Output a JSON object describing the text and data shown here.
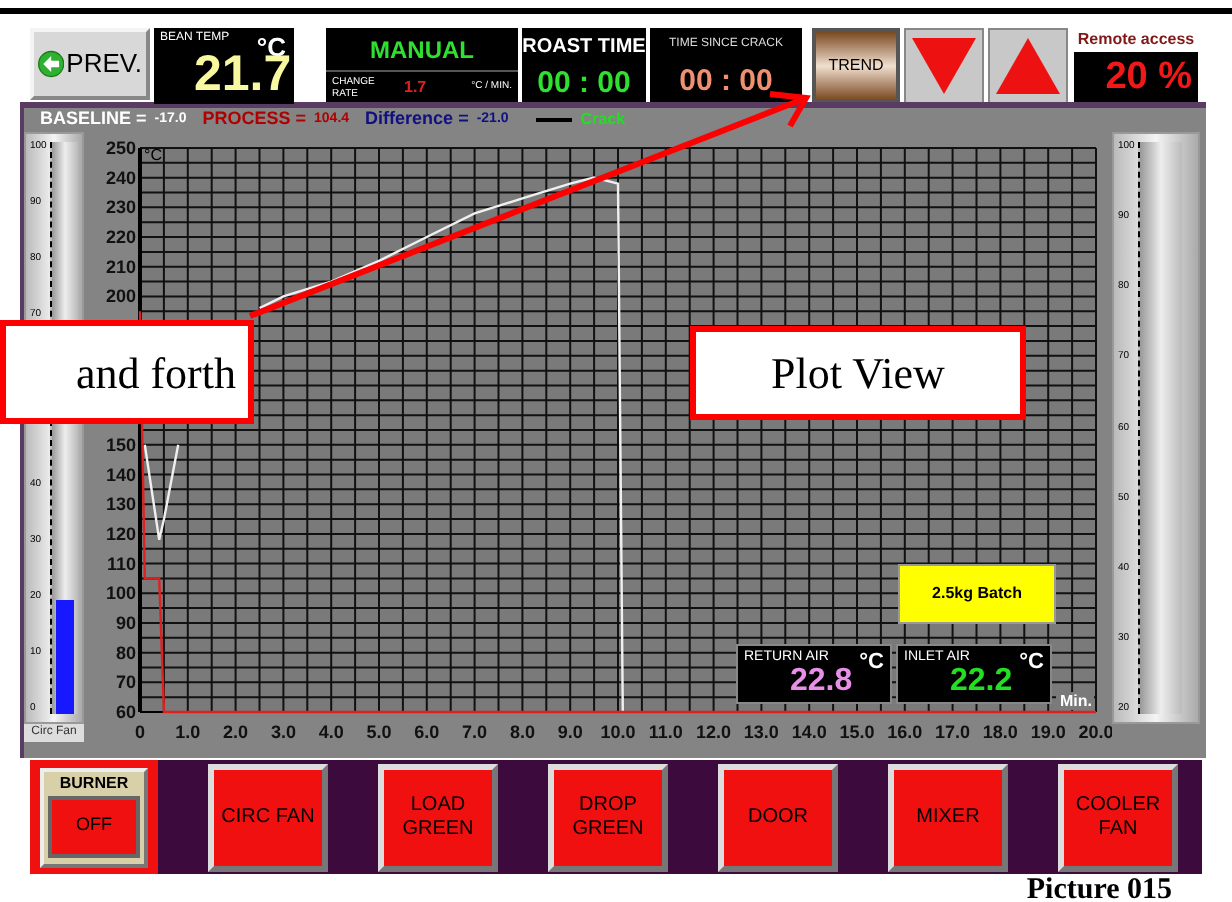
{
  "toolbar": {
    "prev_button": "PREV.",
    "bean_temp": {
      "label": "BEAN TEMP",
      "unit": "°C",
      "value": "21.7"
    },
    "mode": "MANUAL",
    "change_rate": {
      "label": "CHANGE RATE",
      "value": "1.7",
      "unit": "°C / MIN."
    },
    "roast_time": {
      "label": "ROAST TIME",
      "value": "00 : 00"
    },
    "time_since_crack": {
      "label": "TIME SINCE CRACK",
      "value": "00 : 00"
    },
    "trend_button": "TREND",
    "remote_access": {
      "label": "Remote access",
      "value": "20 %"
    }
  },
  "legend": [
    {
      "kind": "reading",
      "label": "BASELINE =",
      "value": "-17.0",
      "color": "#ffffff"
    },
    {
      "kind": "reading",
      "label": "PROCESS =",
      "value": "104.4",
      "color": "#b00000"
    },
    {
      "kind": "reading",
      "label": "Difference =",
      "value": "-21.0",
      "color": "#101080"
    },
    {
      "kind": "line",
      "label": "Crack",
      "color": "#20e020"
    }
  ],
  "left_gauge": {
    "label": "Circ Fan",
    "ticks": [
      "100",
      "90",
      "80",
      "70"
    ],
    "ticks_below_callout": [
      "40",
      "30",
      "20",
      "10",
      "0"
    ],
    "level": 0.2
  },
  "right_gauge": {
    "ticks": [
      "100",
      "90",
      "80",
      "70",
      "60",
      "50",
      "40",
      "30",
      "20"
    ]
  },
  "chart_data": {
    "type": "line",
    "ylabel": "°C",
    "xlabel": "Min.",
    "x": [
      0,
      0.1,
      0.4,
      0.5,
      0.8,
      1,
      2,
      2.5,
      3,
      4,
      5,
      6,
      7,
      8,
      9,
      9.5,
      10,
      10.1,
      20
    ],
    "series": [
      {
        "color": "#f0f0f0",
        "values": [
          null,
          150,
          118,
          125,
          150,
          null,
          null,
          196,
          200,
          205,
          212,
          220,
          228,
          233,
          238,
          240,
          238,
          60,
          null
        ]
      },
      {
        "color": "#e02020",
        "values": [
          195,
          105,
          105,
          60,
          60,
          60,
          60,
          60,
          60,
          60,
          60,
          60,
          60,
          60,
          60,
          60,
          60,
          60,
          60
        ]
      }
    ],
    "grid": true,
    "xlim": [
      0,
      20
    ],
    "ylim": [
      60,
      250
    ],
    "xticks": [
      0,
      {
        "value": 1,
        "label": "1.0"
      },
      {
        "value": 2,
        "label": "2.0"
      },
      {
        "value": 3,
        "label": "3.0"
      },
      {
        "value": 4,
        "label": "4.0"
      },
      {
        "value": 5,
        "label": "5.0"
      },
      {
        "value": 6,
        "label": "6.0"
      },
      {
        "value": 7,
        "label": "7.0"
      },
      {
        "value": 8,
        "label": "8.0"
      },
      {
        "value": 9,
        "label": "9.0"
      },
      {
        "value": 10,
        "label": "10.0"
      },
      {
        "value": 11,
        "label": "11.0"
      },
      {
        "value": 12,
        "label": "12.0"
      },
      {
        "value": 13,
        "label": "13.0"
      },
      {
        "value": 14,
        "label": "14.0"
      },
      {
        "value": 15,
        "label": "15.0"
      },
      {
        "value": 16,
        "label": "16.0"
      },
      {
        "value": 17,
        "label": "17.0"
      },
      {
        "value": 18,
        "label": "18.0"
      },
      {
        "value": 19,
        "label": "19.0"
      },
      {
        "value": 20,
        "label": "20.0"
      }
    ],
    "yticks": [
      60,
      70,
      80,
      90,
      100,
      110,
      120,
      130,
      140,
      150,
      200,
      210,
      220,
      230,
      240,
      250
    ]
  },
  "batch_label": "2.5kg Batch",
  "air_readouts": [
    {
      "label": "RETURN AIR",
      "unit": "°C",
      "value": "22.8",
      "color": "#e890e8"
    },
    {
      "label": "INLET AIR",
      "unit": "°C",
      "value": "22.2",
      "color": "#20e020"
    }
  ],
  "burner": {
    "label": "BURNER",
    "state": "OFF"
  },
  "buttons": [
    "CIRC FAN",
    "LOAD GREEN",
    "DROP GREEN",
    "DOOR",
    "MIXER",
    "COOLER FAN"
  ],
  "callouts": [
    "and forth",
    "Plot View"
  ],
  "caption": "Picture 015"
}
